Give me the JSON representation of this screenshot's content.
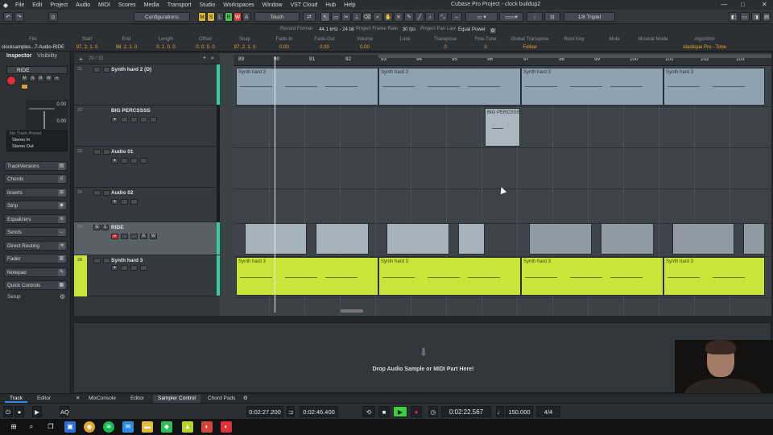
{
  "menubar": {
    "items": [
      "File",
      "Edit",
      "Project",
      "Audio",
      "MIDI",
      "Scores",
      "Media",
      "Transport",
      "Studio",
      "Workspaces",
      "Window",
      "VST Cloud",
      "Hub",
      "Help"
    ],
    "window_title": "Cubase Pro Project - clock buildup2",
    "minimize": "—",
    "maximize": "□",
    "close": "✕"
  },
  "toolbar": {
    "configurations": "Configurations",
    "automation_mode": "Touch",
    "quantize": "1/8  Triplet",
    "m": "M",
    "s": "S",
    "l": "L",
    "r": "R",
    "w": "W",
    "a": "A"
  },
  "infoline": {
    "track_name": "clocksamples...7-Audio-RIDE",
    "headers": [
      "File",
      "Start",
      "End",
      "Length",
      "Offset",
      "Snap",
      "Fade-In",
      "Fade-Out",
      "Volume",
      "Lock",
      "Transpose",
      "Fine-Tune",
      "Global Transpose",
      "Root Key",
      "Mute",
      "Musical Mode",
      "Algorithm"
    ],
    "values": [
      "",
      "97. 2. 1. 0",
      "98. 2. 1. 0",
      "0. 1. 0. 0",
      "0. 0. 0. 0",
      "97. 2. 1. 0",
      "0.00",
      "0.00",
      "0.00",
      "",
      "0",
      "0",
      "Follow",
      "",
      "",
      "",
      "élastique Pro - Time"
    ],
    "project_info": [
      {
        "label": "Record Format",
        "value": "44.1 kHz - 24 bit"
      },
      {
        "label": "Project Frame Rate",
        "value": "30 fps"
      },
      {
        "label": "Project Pan Law",
        "value": "Equal Power"
      }
    ]
  },
  "inspector": {
    "tabs": [
      "Inspector",
      "Visibility"
    ],
    "track_name": "RIDE",
    "fader_values": [
      "0.00",
      "0.00"
    ],
    "routing": [
      "No Track Preset",
      "Stereo In",
      "Stereo Out"
    ],
    "sections": [
      "TrackVersions",
      "Chords",
      "Inserts",
      "Strip",
      "Equalizers",
      "Sends",
      "Direct Routing",
      "Fader",
      "Notepad",
      "Quick Controls",
      "Setup"
    ]
  },
  "tracklist": {
    "zoom_label": "29 / 32",
    "tracks": [
      {
        "num": "21",
        "name": "Synth hard 2 (D)",
        "color": "#2fd1a4"
      },
      {
        "num": "22",
        "name": "BIG PERCSSSS",
        "color": "#1b1e21"
      },
      {
        "num": "23",
        "name": "Audio 01",
        "color": "#1b1e21"
      },
      {
        "num": "24",
        "name": "Audio 02",
        "color": "#1b1e21"
      },
      {
        "num": "25",
        "name": "RIDE",
        "color": "#2fd1a4"
      },
      {
        "num": "28",
        "name": "Synth hard 3",
        "color": "#2fd1a4"
      }
    ]
  },
  "ruler": {
    "bars": [
      "89",
      "90",
      "91",
      "92",
      "93",
      "94",
      "95",
      "96",
      "97",
      "98",
      "99",
      "100",
      "101",
      "102",
      "103"
    ]
  },
  "parts": {
    "synth2": [
      "Synth hard 3",
      "Synth hard 3",
      "Synth hard 3",
      "Synth hard 3"
    ],
    "bigperc": "BIG PERCSSSS",
    "synth3": [
      "Synth hard 3",
      "Synth hard 3",
      "Synth hard 3",
      "Synth hard 3"
    ]
  },
  "lower_zone": {
    "drop_text": "Drop Audio Sample or MIDI Part Here!"
  },
  "bottom_tabs": [
    "Track",
    "Editor",
    "MixConsole",
    "Editor",
    "Sampler Control",
    "Chord Pads"
  ],
  "transport": {
    "left_locator": "0:02:27.200",
    "right_locator": "0:02:46.400",
    "position": "0:02:22.567",
    "tempo": "150.000",
    "signature": "4/4"
  },
  "colors": {
    "accent": "#c9e53a",
    "track_color": "#2fd1a4",
    "record": "#e0303a",
    "play": "#3ad13a"
  }
}
